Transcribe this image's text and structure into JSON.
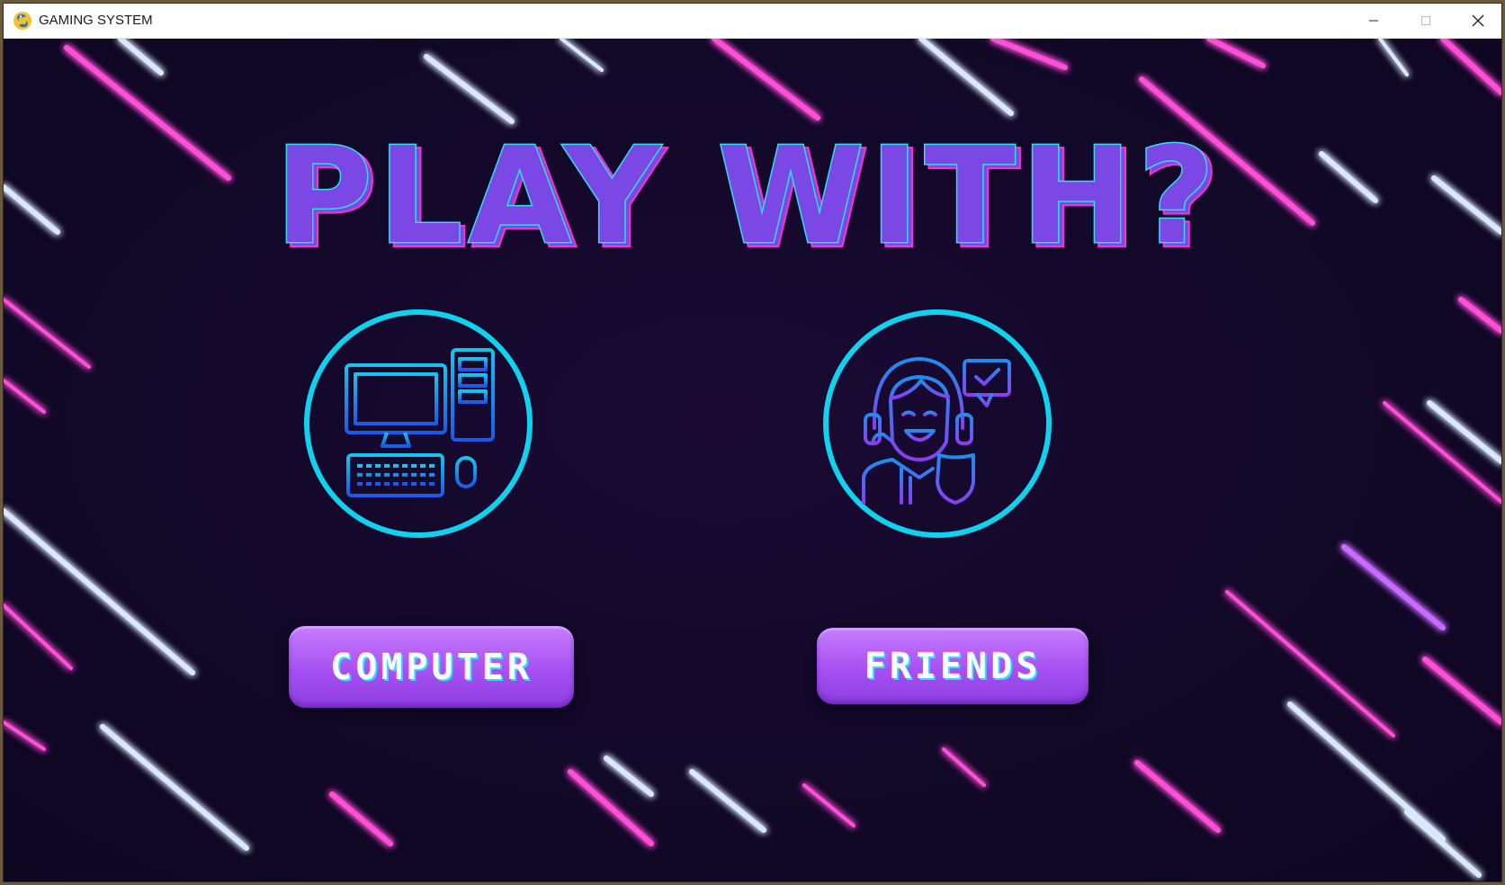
{
  "window": {
    "title": "GAMING SYSTEM",
    "app_icon": "python-snake-icon",
    "controls": [
      "minimize-icon",
      "maximize-icon",
      "close-icon"
    ]
  },
  "screen": {
    "heading": "PLAY WITH?",
    "options": [
      {
        "icon": "desktop-computer-icon",
        "label": "COMPUTER"
      },
      {
        "icon": "friend-with-headset-icon",
        "label": "FRIENDS"
      }
    ]
  },
  "colors": {
    "heading_fill": "#7b48e6",
    "heading_outline_cyan": "#2de0f5",
    "heading_outline_pink": "#ff2fd0",
    "circle_border": "#0fd3ee",
    "button_fill": "#b066f5",
    "background": "#13082a",
    "neon_pink": "#ff4fd8",
    "neon_blue": "#cfe6ff"
  }
}
